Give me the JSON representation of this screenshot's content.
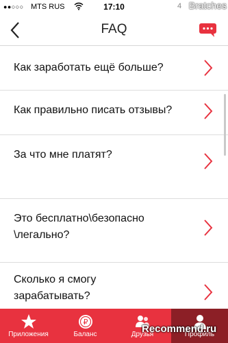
{
  "status_bar": {
    "signal": "●●○○○",
    "carrier": "MTS RUS",
    "time": "17:10",
    "battery": "4",
    "watermark": "Bratches"
  },
  "navbar": {
    "title": "FAQ",
    "back_icon": "chevron-left-icon",
    "chat_icon": "chat-bubble-icon",
    "accent": "#e8323f"
  },
  "faq": {
    "items": [
      {
        "question": "Как заработать ещё больше?"
      },
      {
        "question": "Как правильно писать отзывы?"
      },
      {
        "question": "За что мне платят?"
      },
      {
        "question": "Это бесплатно\\безопасно \\легально?"
      },
      {
        "question": "Сколько я смогу зарабатывать?"
      }
    ]
  },
  "tabbar": {
    "bg": "#e8323f",
    "active_bg": "#8c1f26",
    "tabs": [
      {
        "label": "Приложения",
        "icon": "star-icon"
      },
      {
        "label": "Баланс",
        "icon": "ruble-coin-icon"
      },
      {
        "label": "Друзья",
        "icon": "friends-icon"
      },
      {
        "label": "Профиль",
        "icon": "profile-icon",
        "active": true
      }
    ]
  },
  "overlay": {
    "recommend_text": "Recommend.ru"
  }
}
